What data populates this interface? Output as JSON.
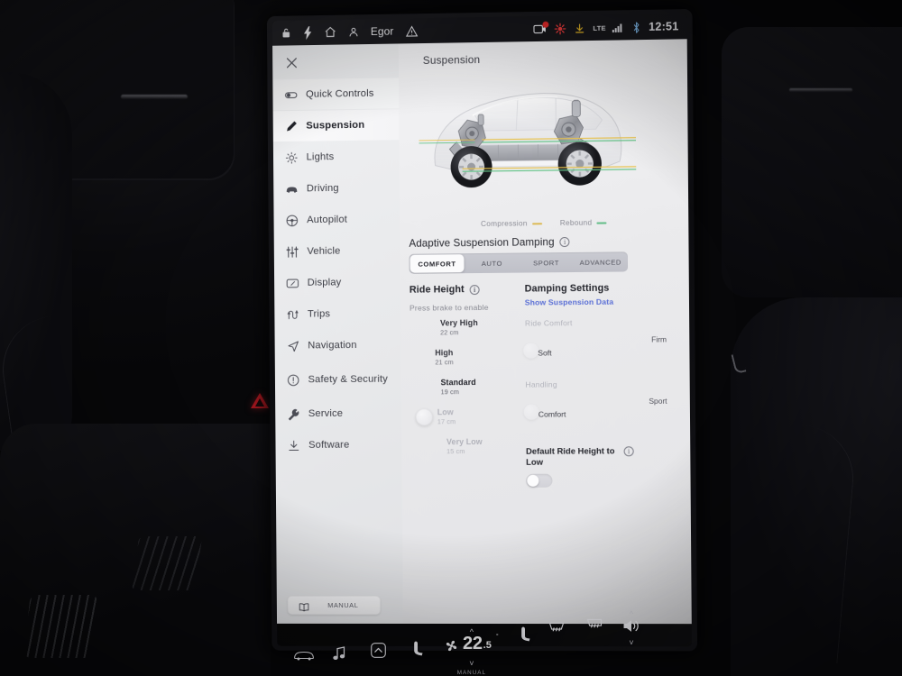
{
  "statusbar": {
    "left_icons": [
      "lock-icon",
      "charging-bolt-icon",
      "home-icon"
    ],
    "driver_name": "Egor",
    "warning_icon": "warning-triangle-icon",
    "right_icons": [
      "dashcam-icon",
      "sentry-mode-icon",
      "software-download-icon"
    ],
    "network_label": "LTE",
    "bluetooth_icon": "bluetooth-icon",
    "clock": "12:51"
  },
  "sidebar": {
    "close_label": "×",
    "items": [
      {
        "label": "Quick Controls",
        "icon": "quick-controls-icon"
      },
      {
        "label": "Suspension",
        "icon": "suspension-icon"
      },
      {
        "label": "Lights",
        "icon": "lights-icon"
      },
      {
        "label": "Driving",
        "icon": "driving-icon"
      },
      {
        "label": "Autopilot",
        "icon": "autopilot-icon"
      },
      {
        "label": "Vehicle",
        "icon": "vehicle-icon"
      },
      {
        "label": "Display",
        "icon": "display-icon"
      },
      {
        "label": "Trips",
        "icon": "trips-icon"
      },
      {
        "label": "Navigation",
        "icon": "navigation-icon"
      },
      {
        "label": "Safety & Security",
        "icon": "safety-security-icon"
      },
      {
        "label": "Service",
        "icon": "service-icon"
      },
      {
        "label": "Software",
        "icon": "software-icon"
      }
    ],
    "manual_button": {
      "label": "MANUAL",
      "icon": "book-icon"
    }
  },
  "main": {
    "title": "Suspension",
    "hero": {
      "legend": [
        {
          "label": "Compression",
          "color": "#f0c64a"
        },
        {
          "label": "Rebound",
          "color": "#63c88a"
        }
      ]
    },
    "damping": {
      "heading": "Adaptive Suspension Damping",
      "info_icon": "info-icon",
      "tabs": [
        "COMFORT",
        "AUTO",
        "SPORT",
        "ADVANCED"
      ],
      "selected_tab": "COMFORT"
    },
    "ride_height": {
      "heading": "Ride Height",
      "info_icon": "info-icon",
      "hint": "Press brake to enable",
      "options": [
        {
          "name": "Very High",
          "value": "22 cm"
        },
        {
          "name": "High",
          "value": "21 cm"
        },
        {
          "name": "Standard",
          "value": "19 cm"
        },
        {
          "name": "Low",
          "value": "17 cm"
        },
        {
          "name": "Very Low",
          "value": "15 cm"
        }
      ],
      "selected": "Standard"
    },
    "damping_settings": {
      "heading": "Damping Settings",
      "link": "Show Suspension Data",
      "sliders": [
        {
          "title": "Ride Comfort",
          "left": "Soft",
          "right": "Firm"
        },
        {
          "title": "Handling",
          "left": "Comfort",
          "right": "Sport"
        }
      ],
      "default_ride_height": {
        "label": "Default Ride Height to Low",
        "info_icon": "info-icon",
        "enabled": false
      }
    }
  },
  "climate": {
    "icons": {
      "car": "car-icon",
      "media": "media-note-icon",
      "apps": "apps-icon",
      "seat_left": "seat-heater-left-icon",
      "seat_right": "seat-heater-right-icon",
      "defrost_rear": "rear-defrost-icon",
      "defrost_front": "front-defrost-icon",
      "fan": "fan-icon",
      "volume": "volume-icon",
      "chevron_up": "chevron-up-icon",
      "chevron_down": "chevron-down-icon"
    },
    "temperature_whole": "22",
    "temperature_frac": ".5",
    "temperature_degree": "°",
    "mode_label": "MANUAL"
  }
}
